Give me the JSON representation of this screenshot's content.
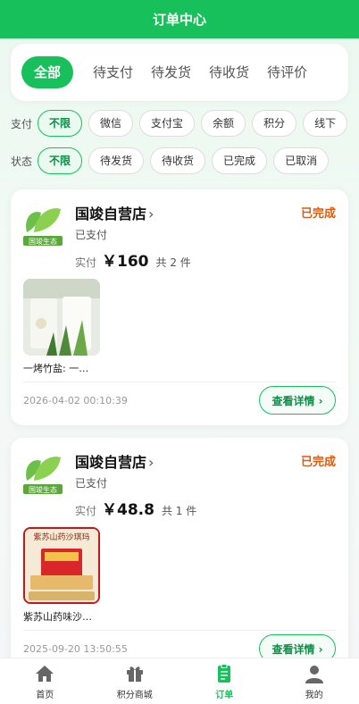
{
  "header": {
    "title": "订单中心"
  },
  "tabs": [
    "全部",
    "待支付",
    "待发货",
    "待收货",
    "待评价"
  ],
  "payment_filter": {
    "label": "支付",
    "options": [
      "不限",
      "微信",
      "支付宝",
      "余额",
      "积分",
      "线下"
    ]
  },
  "status_filter": {
    "label": "状态",
    "options": [
      "不限",
      "待发货",
      "待收货",
      "已完成",
      "已取消"
    ]
  },
  "orders": [
    {
      "shop_name": "国竣自营店",
      "arrow": "›",
      "status": "已完成",
      "pay_status": "已支付",
      "paid_label": "实付",
      "price": "￥160",
      "count": "共 2 件",
      "product_name": "一烤竹盐: 一…",
      "date": "2026-04-02 00:10:39",
      "detail_button": "查看详情 ›",
      "logo_text": "国竣生态"
    },
    {
      "shop_name": "国竣自营店",
      "arrow": "›",
      "status": "已完成",
      "pay_status": "已支付",
      "paid_label": "实付",
      "price": "￥48.8",
      "count": "共 1 件",
      "product_name": "紫苏山药味沙…",
      "date": "2025-09-20 13:50:55",
      "detail_button": "查看详情 ›",
      "logo_text": "国竣生态",
      "thumb_text": "紫苏山药沙琪玛"
    }
  ],
  "tabbar": [
    {
      "label": "首页",
      "icon": "home-icon"
    },
    {
      "label": "积分商城",
      "icon": "gift-icon"
    },
    {
      "label": "订单",
      "icon": "order-icon"
    },
    {
      "label": "我的",
      "icon": "user-icon"
    }
  ],
  "colors": {
    "primary": "#17c05b",
    "status_done": "#e05a0a"
  }
}
